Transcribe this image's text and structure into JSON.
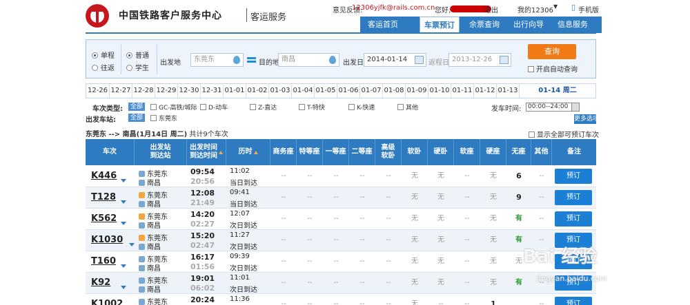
{
  "header": {
    "site_title": "中国铁路客户服务中心",
    "site_subtitle": "客运服务",
    "feedback_label": "意见反馈:",
    "feedback_email": "12306yjfk@rails.com.cn",
    "greeting": "您好,",
    "logout": "退出",
    "my12306": "我的12306",
    "mobile": "手机版"
  },
  "nav": {
    "items": [
      {
        "label": "客运首页"
      },
      {
        "label": "车票预订"
      },
      {
        "label": "余票查询"
      },
      {
        "label": "出行向导"
      },
      {
        "label": "信息服务"
      }
    ]
  },
  "search": {
    "trip_one_way": "单程",
    "trip_round": "往返",
    "ticket_normal": "普通",
    "ticket_student": "学生",
    "from_label": "出发地",
    "from_value": "东莞东",
    "to_label": "目的地",
    "to_value": "南昌",
    "depart_label": "出发日",
    "depart_value": "2014-01-14",
    "return_label": "返程日",
    "return_value": "2013-12-26",
    "query_button": "查询",
    "auto_query": "开启自动查询"
  },
  "dates": {
    "items": [
      "12-26",
      "12-27",
      "12-28",
      "12-29",
      "12-30",
      "12-31",
      "01-01",
      "01-02",
      "01-03",
      "01-04",
      "01-05",
      "01-06",
      "01-07",
      "01-08",
      "01-09",
      "01-10",
      "01-11",
      "01-12",
      "01-13"
    ],
    "selected": "01-14 周二"
  },
  "filters": {
    "train_type_label": "车次类型:",
    "all_label": "全部",
    "types": [
      "GC-高铁/城际",
      "D-动车",
      "Z-直达",
      "T-特快",
      "K-快速",
      "其他"
    ],
    "depart_station_label": "出发车站:",
    "depart_station_all": "全部",
    "depart_station": "东莞东",
    "time_label": "发车时间:",
    "time_value": "00:00--24:00",
    "more_options": "更多选项"
  },
  "route": {
    "text": "东莞东 --> 南昌(1月14日 周二)",
    "count": "共计9个车次",
    "show_all": "显示全部可预订车次"
  },
  "table": {
    "headers": [
      "车次",
      "出发站\n到达站",
      "出发时间\n到达时间",
      "历时",
      "商务座",
      "特等座",
      "一等座",
      "二等座",
      "高级\n软卧",
      "软卧",
      "硬卧",
      "软座",
      "硬座",
      "无座",
      "其他",
      "备注"
    ],
    "book_label": "预订",
    "rows": [
      {
        "train": "K446",
        "from": "东莞东",
        "to": "南昌",
        "dep": "09:54",
        "arr": "20:56",
        "dur": "11:02",
        "day": "当日到达",
        "start": false,
        "seats": [
          "--",
          "--",
          "--",
          "--",
          "--",
          "无",
          "无",
          "--",
          "无",
          "6",
          "--"
        ]
      },
      {
        "train": "T128",
        "from": "东莞东",
        "to": "南昌",
        "dep": "12:08",
        "arr": "21:49",
        "dur": "09:41",
        "day": "当日到达",
        "start": true,
        "seats": [
          "--",
          "--",
          "--",
          "--",
          "--",
          "无",
          "无",
          "--",
          "无",
          "9",
          "--"
        ]
      },
      {
        "train": "K562",
        "from": "东莞东",
        "to": "南昌",
        "dep": "14:20",
        "arr": "02:27",
        "dur": "12:07",
        "day": "次日到达",
        "start": true,
        "seats": [
          "--",
          "--",
          "--",
          "--",
          "--",
          "无",
          "无",
          "--",
          "无",
          "有",
          "--"
        ]
      },
      {
        "train": "K1030",
        "from": "东莞东",
        "to": "南昌",
        "dep": "15:20",
        "arr": "02:47",
        "dur": "11:27",
        "day": "次日到达",
        "start": true,
        "seats": [
          "--",
          "--",
          "--",
          "--",
          "--",
          "无",
          "无",
          "--",
          "无",
          "有",
          "--"
        ]
      },
      {
        "train": "T160",
        "from": "东莞东",
        "to": "南昌",
        "dep": "16:17",
        "arr": "01:56",
        "dur": "09:39",
        "day": "次日到达",
        "start": false,
        "seats": [
          "--",
          "--",
          "--",
          "--",
          "--",
          "无",
          "无",
          "--",
          "无",
          "无",
          "--"
        ]
      },
      {
        "train": "K92",
        "from": "东莞东",
        "to": "南昌",
        "dep": "19:01",
        "arr": "06:02",
        "dur": "11:01",
        "day": "次日到达",
        "start": false,
        "seats": [
          "--",
          "--",
          "--",
          "--",
          "--",
          "无",
          "无",
          "--",
          "无",
          "有",
          "--"
        ]
      },
      {
        "train": "K1002",
        "from": "东莞东",
        "to": "南昌",
        "dep": "20:24",
        "arr": "",
        "dur": "11:36",
        "day": "",
        "start": false,
        "seats": [
          "--",
          "--",
          "--",
          "--",
          "--",
          "无",
          "--",
          "--",
          "1",
          "",
          "--"
        ]
      }
    ]
  },
  "watermark": {
    "main": "Bai 经验",
    "sub": "jingyan.baidu.com"
  },
  "colors": {
    "brand_blue": "#2f7bc2",
    "book_blue": "#1c7fd6",
    "query_orange": "#f07a16",
    "logo_red": "#c8161d",
    "available_green": "#2c9b2c"
  }
}
